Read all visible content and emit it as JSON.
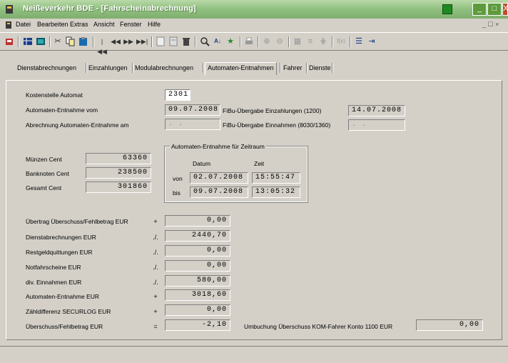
{
  "window": {
    "title": "Neißeverkehr BDE - [Fahrscheinabrechnung]",
    "buttons": {
      "minimize": "_",
      "maximize": "□",
      "close": "X"
    }
  },
  "menu": {
    "items": [
      "Datei",
      "Bearbeiten",
      "Extras",
      "Ansicht",
      "Fenster",
      "Hilfe"
    ],
    "child_controls": "_ ☐ ×"
  },
  "toolbar": {
    "icons": [
      "app-icon",
      "grid-icon",
      "table-icon",
      "cut-icon",
      "copy-icon",
      "paste-icon",
      "first-record-icon",
      "prev-page-icon",
      "next-page-icon",
      "last-record-icon",
      "doc1-icon",
      "doc2-icon",
      "delete-icon",
      "search-icon",
      "sort-icon",
      "filter-icon",
      "print-icon",
      "zoom-in-icon",
      "zoom-out-icon",
      "calc-icon",
      "list-icon",
      "formula-icon",
      "bullet-list-icon",
      "indent-icon"
    ]
  },
  "tabs": [
    "Dienstabrechnungen",
    "Einzahlungen",
    "Modulabrechnungen",
    "Automaten-Entnahmen",
    "Fahrer",
    "Dienste"
  ],
  "active_tab": "Automaten-Entnahmen",
  "form": {
    "kostenstelle_label": "Kostenstelle Automat",
    "kostenstelle_value": "2301",
    "entnahme_vom_label": "Automaten-Entnahme vom",
    "entnahme_vom_value": "09.07.2008",
    "abrechnung_label": "Abrechnung Automaten-Entnahme am",
    "abrechnung_value": " .  . ",
    "fibu_einzahlungen_label": "FiBu-Übergabe Einzahlungen (1200)",
    "fibu_einzahlungen_value": "14.07.2008",
    "fibu_einnahmen_label": "FiBu-Übergabe Einnahmen (8030/1360)",
    "fibu_einnahmen_value": " .  . ",
    "muenzen_label": "Münzen Cent",
    "muenzen_value": "63360",
    "banknoten_label": "Banknoten Cent",
    "banknoten_value": "238500",
    "gesamt_label": "Gesamt Cent",
    "gesamt_value": "301860",
    "zeitraum": {
      "title": "Automaten-Entnahme für Zeitraum",
      "datum_header": "Datum",
      "zeit_header": "Zeit",
      "von_label": "von",
      "von_datum": "02.07.2008",
      "von_zeit": "15:55:47",
      "bis_label": "bis",
      "bis_datum": "09.07.2008",
      "bis_zeit": "13:05:32"
    },
    "rows": [
      {
        "label": "Übertrag Überschuss/Fehlbetrag EUR",
        "op": "+",
        "value": "0,00"
      },
      {
        "label": "Dienstabrechnungen EUR",
        "op": "./.",
        "value": "2440,70"
      },
      {
        "label": "Restgeldquittungen EUR",
        "op": "./.",
        "value": "0,00"
      },
      {
        "label": "Notfahrscheine EUR",
        "op": "./.",
        "value": "0,00"
      },
      {
        "label": "div. Einnahmen EUR",
        "op": "./.",
        "value": "580,00"
      },
      {
        "label": "Automaten-Entnahme EUR",
        "op": "+",
        "value": "3018,60"
      },
      {
        "label": "Zähldifferenz SECURLOG EUR",
        "op": "+",
        "value": "0,00"
      },
      {
        "label": "Überschuss/Fehlbetrag EUR",
        "op": "=",
        "value": "-2,10"
      }
    ],
    "umbuchung_label": "Umbuchung Überschuss KOM-Fahrer Konto 1100 EUR",
    "umbuchung_value": "0,00"
  }
}
